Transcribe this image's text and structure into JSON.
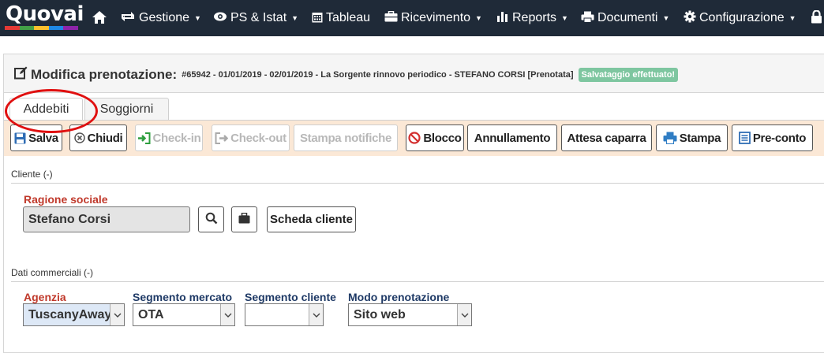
{
  "app": {
    "logo": "Quovai",
    "logo_colors": [
      "#e53935",
      "#43a047",
      "#fbc02d",
      "#1e88e5",
      "#8e24aa"
    ]
  },
  "nav": {
    "items": [
      {
        "label": "Gestione",
        "icon": "transfer-icon"
      },
      {
        "label": "PS & Istat",
        "icon": "eye-icon"
      },
      {
        "label": "Tableau",
        "icon": "calendar-icon"
      },
      {
        "label": "Ricevimento",
        "icon": "briefcase-icon"
      },
      {
        "label": "Reports",
        "icon": "bar-chart-icon"
      },
      {
        "label": "Documenti",
        "icon": "printer-icon"
      },
      {
        "label": "Configurazione",
        "icon": "gear-icon"
      }
    ]
  },
  "header": {
    "title": "Modifica prenotazione:",
    "info": "#65942 - 01/01/2019 - 02/01/2019 - La Sorgente rinnovo periodico - STEFANO CORSI [Prenotata]",
    "badge": "Salvataggio effettuato!"
  },
  "tabs": [
    {
      "label": "Addebiti",
      "active": true
    },
    {
      "label": "Soggiorni",
      "active": false
    }
  ],
  "toolbar": {
    "save": "Salva",
    "close": "Chiudi",
    "checkin": "Check-in",
    "checkout": "Check-out",
    "print_notifications": "Stampa notifiche",
    "block": "Blocco",
    "cancel": "Annullamento",
    "deposit_wait": "Attesa caparra",
    "print": "Stampa",
    "pre_bill": "Pre-conto"
  },
  "client": {
    "section": "Cliente (-)",
    "company_label": "Ragione sociale",
    "company_value": "Stefano Corsi",
    "client_card_button": "Scheda cliente"
  },
  "commercial": {
    "section": "Dati commerciali (-)",
    "agency_label": "Agenzia",
    "agency_value": "TuscanyAway",
    "market_segment_label": "Segmento mercato",
    "market_segment_value": "OTA",
    "client_segment_label": "Segmento cliente",
    "client_segment_value": "",
    "booking_mode_label": "Modo prenotazione",
    "booking_mode_value": "Sito web"
  }
}
